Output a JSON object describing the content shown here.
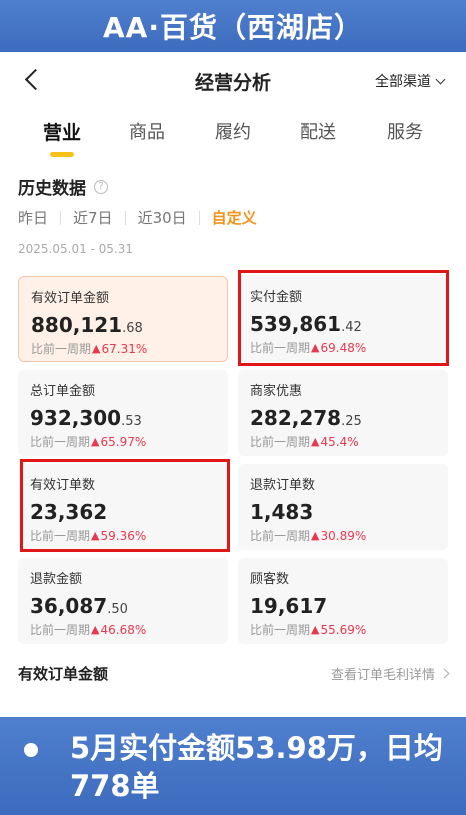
{
  "banner": {
    "title": "AA·百货（西湖店）"
  },
  "navbar": {
    "title": "经营分析",
    "channel_label": "全部渠道"
  },
  "tabs": [
    {
      "label": "营业",
      "active": true
    },
    {
      "label": "商品",
      "active": false
    },
    {
      "label": "履约",
      "active": false
    },
    {
      "label": "配送",
      "active": false
    },
    {
      "label": "服务",
      "active": false
    }
  ],
  "section": {
    "title": "历史数据",
    "help_icon": "question-circle-icon"
  },
  "ranges": [
    {
      "label": "昨日",
      "active": false
    },
    {
      "label": "近7日",
      "active": false
    },
    {
      "label": "近30日",
      "active": false
    },
    {
      "label": "自定义",
      "active": true
    }
  ],
  "date_range": "2025.05.01 - 05.31",
  "compare_label": "比前一周期",
  "cards": [
    {
      "label": "有效订单金额",
      "int": "880,121",
      "dec": ".68",
      "pct": "67.31%"
    },
    {
      "label": "实付金额",
      "int": "539,861",
      "dec": ".42",
      "pct": "69.48%"
    },
    {
      "label": "总订单金额",
      "int": "932,300",
      "dec": ".53",
      "pct": "65.97%"
    },
    {
      "label": "商家优惠",
      "int": "282,278",
      "dec": ".25",
      "pct": "45.4%"
    },
    {
      "label": "有效订单数",
      "int": "23,362",
      "dec": "",
      "pct": "59.36%"
    },
    {
      "label": "退款订单数",
      "int": "1,483",
      "dec": "",
      "pct": "30.89%"
    },
    {
      "label": "退款金额",
      "int": "36,087",
      "dec": ".50",
      "pct": "46.68%"
    },
    {
      "label": "顾客数",
      "int": "19,617",
      "dec": "",
      "pct": "55.69%"
    }
  ],
  "bottom": {
    "title": "有效订单金额",
    "detail_link": "查看订单毛利详情"
  },
  "summary": {
    "text": "5月实付金额53.98万，日均778单"
  },
  "colors": {
    "accent": "#f0951c",
    "up": "#e8384f",
    "banner": "#4475c6",
    "highlight_box": "#e01717"
  }
}
